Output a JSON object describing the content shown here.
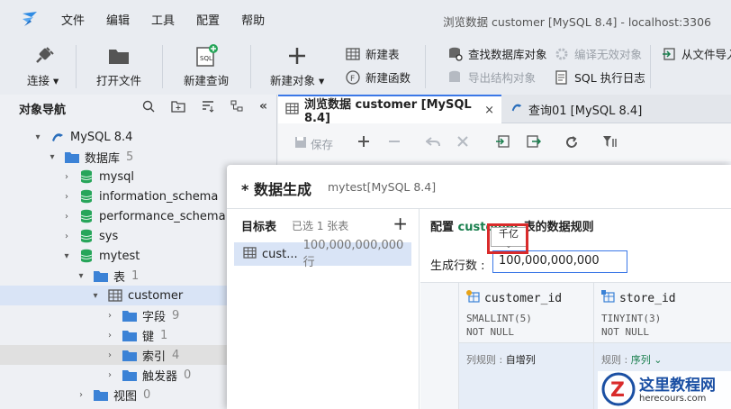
{
  "window": {
    "title": "浏览数据 customer [MySQL 8.4]  - localhost:3306"
  },
  "menu": [
    "文件",
    "编辑",
    "工具",
    "配置",
    "帮助"
  ],
  "toolbar": {
    "connect": "连接",
    "open_file": "打开文件",
    "new_query": "新建查询",
    "new_object": "新建对象",
    "new_table": "新建表",
    "new_function": "新建函数",
    "find_object": "查找数据库对象",
    "export_structure": "导出结构对象",
    "compile_invalid": "编译无效对象",
    "sql_log": "SQL 执行日志",
    "import_file": "从文件导入"
  },
  "navigator": {
    "title": "对象导航",
    "tree": [
      {
        "label": "MySQL 8.4",
        "count": ""
      },
      {
        "label": "数据库",
        "count": "5"
      },
      {
        "label": "mysql",
        "count": ""
      },
      {
        "label": "information_schema",
        "count": ""
      },
      {
        "label": "performance_schema",
        "count": ""
      },
      {
        "label": "sys",
        "count": ""
      },
      {
        "label": "mytest",
        "count": ""
      },
      {
        "label": "表",
        "count": "1"
      },
      {
        "label": "customer",
        "count": ""
      },
      {
        "label": "字段",
        "count": "9"
      },
      {
        "label": "键",
        "count": "1"
      },
      {
        "label": "索引",
        "count": "4"
      },
      {
        "label": "触发器",
        "count": "0"
      },
      {
        "label": "视图",
        "count": "0"
      }
    ]
  },
  "tabs": [
    {
      "label": "浏览数据 customer [MySQL 8.4]",
      "close": "×"
    },
    {
      "label": "查询01 [MySQL 8.4]"
    }
  ],
  "subtoolbar": {
    "save": "保存"
  },
  "dialog": {
    "title": "* 数据生成",
    "subtitle": "mytest[MySQL 8.4]",
    "target_header": "目标表",
    "target_selected": "已选 1 张表",
    "target_add": "+",
    "target_item_name": "cust...",
    "target_item_rows": "100,000,000,000行",
    "config_prefix": "配置 ",
    "config_table": "customer",
    "config_suffix": " 表的数据规则",
    "gen_rows_label": "生成行数 :",
    "gen_rows_value": "100,000,000,000",
    "tooltip": "千亿",
    "columns": [
      {
        "name": "customer_id",
        "type": "SMALLINT(5)",
        "null": "NOT NULL",
        "rule_label": "列规则 :",
        "rule_value": "自增列"
      },
      {
        "name": "store_id",
        "type": "TINYINT(3)",
        "null": "NOT NULL",
        "rule_label": "规则 :",
        "rule_value": "序列"
      }
    ]
  },
  "watermark": {
    "text": "这里教程网",
    "url": "herecours.com"
  }
}
